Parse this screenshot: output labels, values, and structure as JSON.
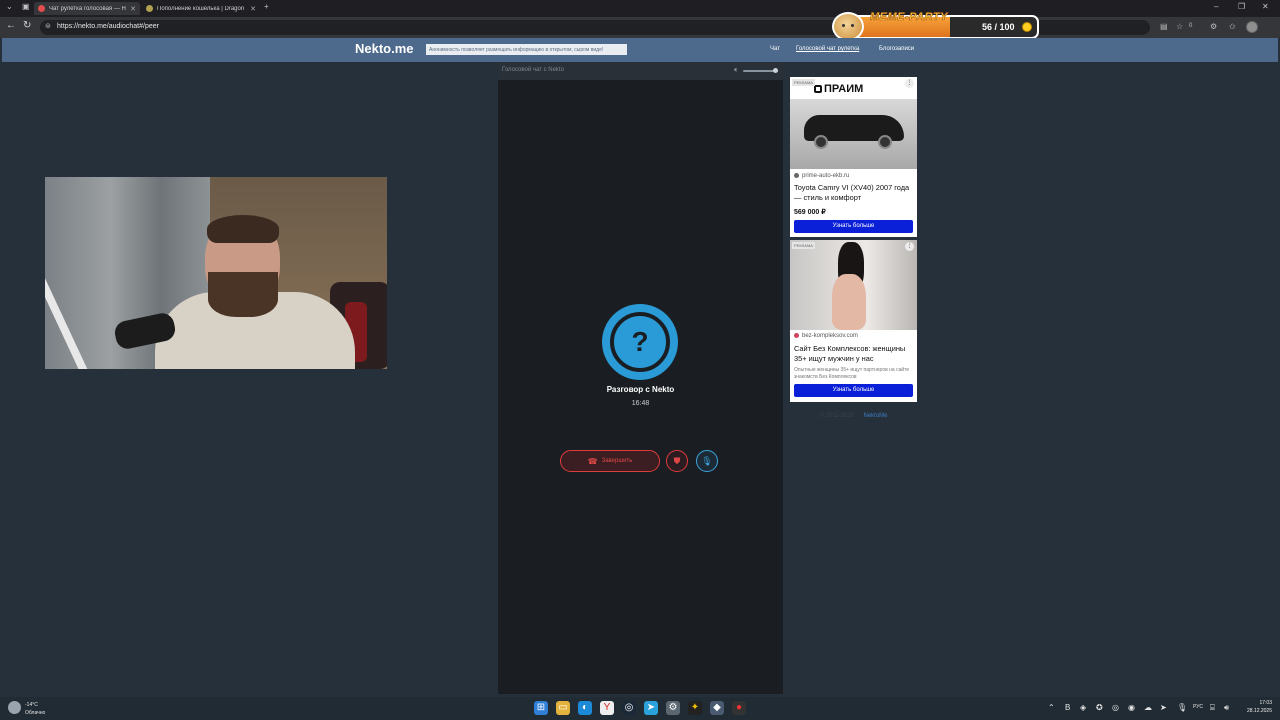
{
  "browser": {
    "tabs": [
      {
        "title": "Чат рулетка голосовая — Н",
        "active": true
      },
      {
        "title": "Пополнение кошелька | Dragon",
        "active": false
      }
    ],
    "url": "https://nekto.me/audiochat#/peer",
    "extension_count": "0"
  },
  "meme_party": {
    "label": "MEME-PARTY",
    "score": "56 / 100",
    "progress": 0.56
  },
  "site": {
    "logo": "Nekto.me",
    "notice": "Анонимность позволяет размещать информацию в открытом, сыром виде!",
    "nav": [
      "Чат",
      "Голосовой чат рулетка",
      "Блогозаписи"
    ]
  },
  "panel": {
    "title": "Голосовой чат с Nekto",
    "volume": 0.9,
    "conversation_title": "Разговор с Nekto",
    "timer": "16:48",
    "end_button": "Завершить"
  },
  "ads": [
    {
      "tag": "РЕКЛАМА",
      "brand": "ПРАИМ",
      "domain": "prime-auto-ekb.ru",
      "headline": "Toyota Camry VI (XV40) 2007 года — стиль и комфорт",
      "price": "569 000 ₽",
      "cta": "Узнать больше"
    },
    {
      "tag": "РЕКЛАМА",
      "domain": "bez-kompleksov.com",
      "headline": "Сайт Без Комплексов: женщины 35+ ищут мужчин у нас",
      "description": "Опытные женщины 35+ ищут партнеров на сайте знакомств Без Комплексов",
      "cta": "Узнать больше"
    }
  ],
  "footer": {
    "copyright": "© 2011-2025",
    "link": "NektoMe"
  },
  "taskbar": {
    "weather_temp": "-14°C",
    "weather_cond": "Облачно",
    "language": "РУС",
    "time": "17:03",
    "date": "28.12.2025"
  },
  "colors": {
    "header": "#4d6a8c",
    "accent_blue": "#2a9bd6",
    "danger": "#e03b3b",
    "ad_button": "#0a1fd8"
  }
}
